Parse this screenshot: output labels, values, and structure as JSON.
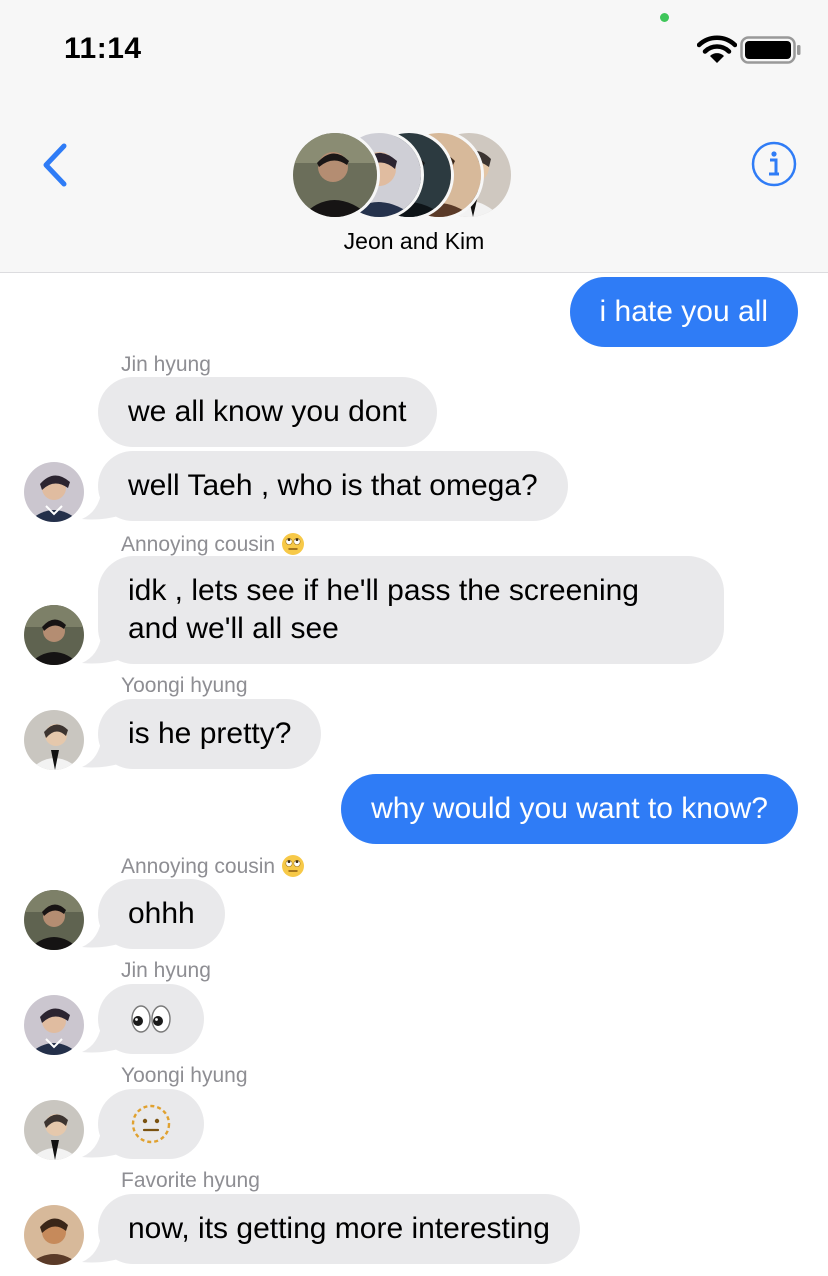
{
  "status": {
    "time": "11:14"
  },
  "header": {
    "title": "Jeon and Kim"
  },
  "messages": [
    {
      "type": "out",
      "text": "i hate you all"
    },
    {
      "type": "in",
      "sender": "Jin hyung",
      "text": "we all know you dont"
    },
    {
      "type": "in",
      "text": "well Taeh , who is that omega?"
    },
    {
      "type": "in",
      "sender": "Annoying cousin",
      "sender_emoji": "face-with-rolling-eyes",
      "line1": "idk , lets see if he'll pass the screening",
      "line2": "and we'll all see"
    },
    {
      "type": "in",
      "sender": "Yoongi hyung",
      "text": "is he pretty?"
    },
    {
      "type": "out",
      "text": "why would you want to know?"
    },
    {
      "type": "in",
      "sender": "Annoying cousin",
      "sender_emoji": "face-with-rolling-eyes",
      "text": "ohhh"
    },
    {
      "type": "in",
      "sender": "Jin hyung",
      "emoji": "eyes"
    },
    {
      "type": "in",
      "sender": "Yoongi hyung",
      "emoji": "dotted-line-face"
    },
    {
      "type": "in",
      "sender": "Favorite hyung",
      "text": "now, its getting more interesting"
    }
  ],
  "colors": {
    "accent": "#2f7cf6",
    "incoming_bubble": "#e9e9eb",
    "sender_label": "#8e8e93"
  }
}
